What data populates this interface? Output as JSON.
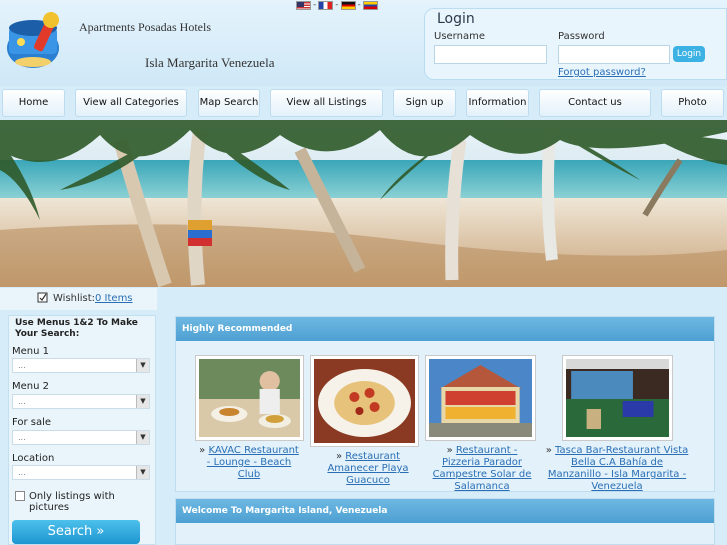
{
  "header": {
    "title": "Apartments Posadas Hotels",
    "subtitle": "Isla Margarita Venezuela",
    "flag_separator": "-"
  },
  "login": {
    "title": "Login",
    "username_label": "Username",
    "username_value": "",
    "password_label": "Password",
    "password_value": "",
    "button": "Login",
    "forgot": "Forgot password?"
  },
  "nav": {
    "items": [
      "Home",
      "View all Categories",
      "Map Search",
      "View all Listings",
      "Sign up",
      "Information",
      "Contact us",
      "Photo Gallery"
    ]
  },
  "wishlist": {
    "label": "Wishlist:",
    "count": "0 Items"
  },
  "sidebar": {
    "title": "Use Menus 1&2 To Make Your Search:",
    "menu1_label": "Menu 1",
    "menu1_value": "...",
    "menu2_label": "Menu 2",
    "menu2_value": "...",
    "forsale_label": "For sale",
    "forsale_value": "...",
    "location_label": "Location",
    "location_value": "...",
    "checkbox_label": "Only listings with pictures",
    "search_button": "Search »"
  },
  "highly_recommended": {
    "title": "Highly Recommended",
    "prefix": "»",
    "items": [
      {
        "title": "KAVAC Restaurant - Lounge - Beach Club"
      },
      {
        "title": "Restaurant Amanecer Playa Guacuco"
      },
      {
        "title": "Restaurant - Pizzeria Parador Campestre Solar de Salamanca"
      },
      {
        "title": "Tasca Bar-Restaurant Vista Bella C.A Bahía de Manzanillo - Isla Margarita - Venezuela"
      }
    ]
  },
  "welcome": {
    "title": "Welcome To Margarita Island, Venezuela"
  },
  "colors": {
    "accent": "#4d9fd2",
    "link": "#2a6fb5",
    "button": "#1e95d0",
    "background": "#d6ecf9"
  }
}
